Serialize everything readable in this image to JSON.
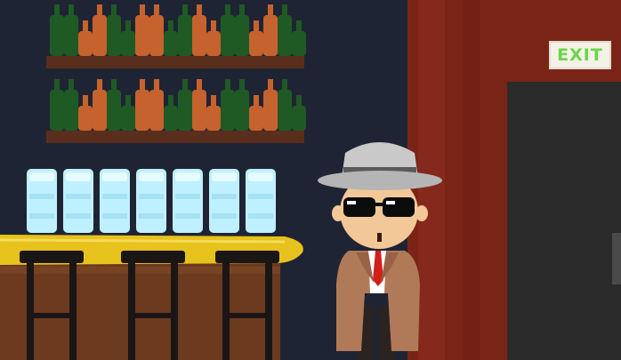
{
  "scene": {
    "name": "bar",
    "colors": {
      "wall": "#1f2434",
      "brick": "#7a2418",
      "door": "#2a2a2a",
      "shelf": "#5a2e1d",
      "bottle_green": "#1f5a24",
      "bottle_orange": "#c6622e",
      "glass": "#bff0ff",
      "counter_top": "#e8c21c",
      "counter_front": "#6b3a1f",
      "stool": "#1a1616"
    }
  },
  "exit_sign": {
    "label": "EXIT"
  },
  "character": {
    "outfit": [
      "fedora-hat",
      "sunglasses",
      "trench-coat",
      "red-tie"
    ]
  },
  "items": {
    "bottle_shelves": 2,
    "glasses": 7,
    "stools": 3
  }
}
